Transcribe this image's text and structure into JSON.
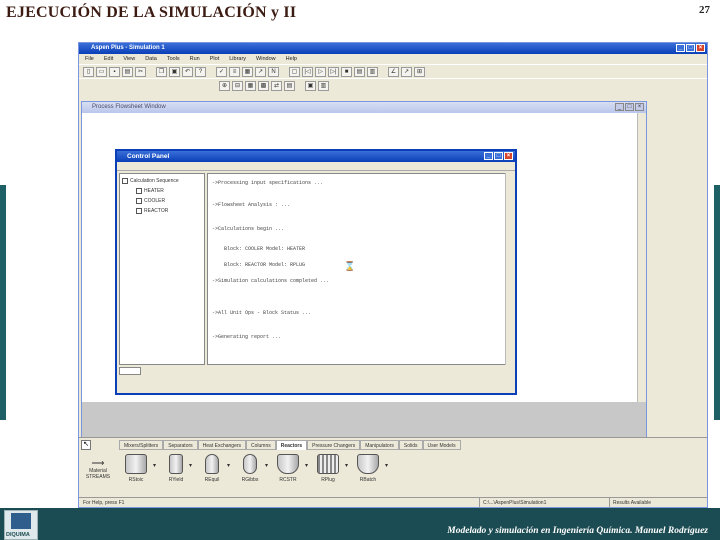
{
  "slide": {
    "title": "EJECUCIÓN DE LA SIMULACIÓN y II",
    "page_number": "27",
    "footer": "Modelado y simulación en Ingeniería Química. Manuel Rodríguez",
    "logo_text": "DIQUIMA"
  },
  "app": {
    "title": "Aspen Plus - Simulation 1",
    "menu": [
      "File",
      "Edit",
      "View",
      "Data",
      "Tools",
      "Run",
      "Plot",
      "Library",
      "Window",
      "Help"
    ],
    "flowsheet_title": "Process Flowsheet Window"
  },
  "control_panel": {
    "title": "Control Panel",
    "tree_root": "Calculation Sequence",
    "tree_items": [
      "HEATER",
      "COOLER",
      "REACTOR"
    ],
    "log_lines": [
      "->Processing input specifications ...",
      "->Flowsheet Analysis : ...",
      "->Calculations begin ...",
      "Block: COOLER   Model: HEATER",
      "Block: REACTOR  Model: RPLUG",
      "->Simulation calculations completed ...",
      "->All Unit Ops - Block Status ...",
      "->Generating report ..."
    ]
  },
  "palette": {
    "tabs": [
      "Mixers/Splitters",
      "Separators",
      "Heat Exchangers",
      "Columns",
      "Reactors",
      "Pressure Changers",
      "Manipulators",
      "Solids",
      "User Models"
    ],
    "active_tab": "Reactors",
    "stream_label": "Material STREAMS",
    "units": [
      "RStoic",
      "RYield",
      "REquil",
      "RGibbs",
      "RCSTR",
      "RPlug",
      "RBatch"
    ]
  },
  "statusbar": {
    "left": "For Help, press F1",
    "middle": "C:\\...\\AspenPlus\\Simulation1",
    "right": "Results Available"
  }
}
